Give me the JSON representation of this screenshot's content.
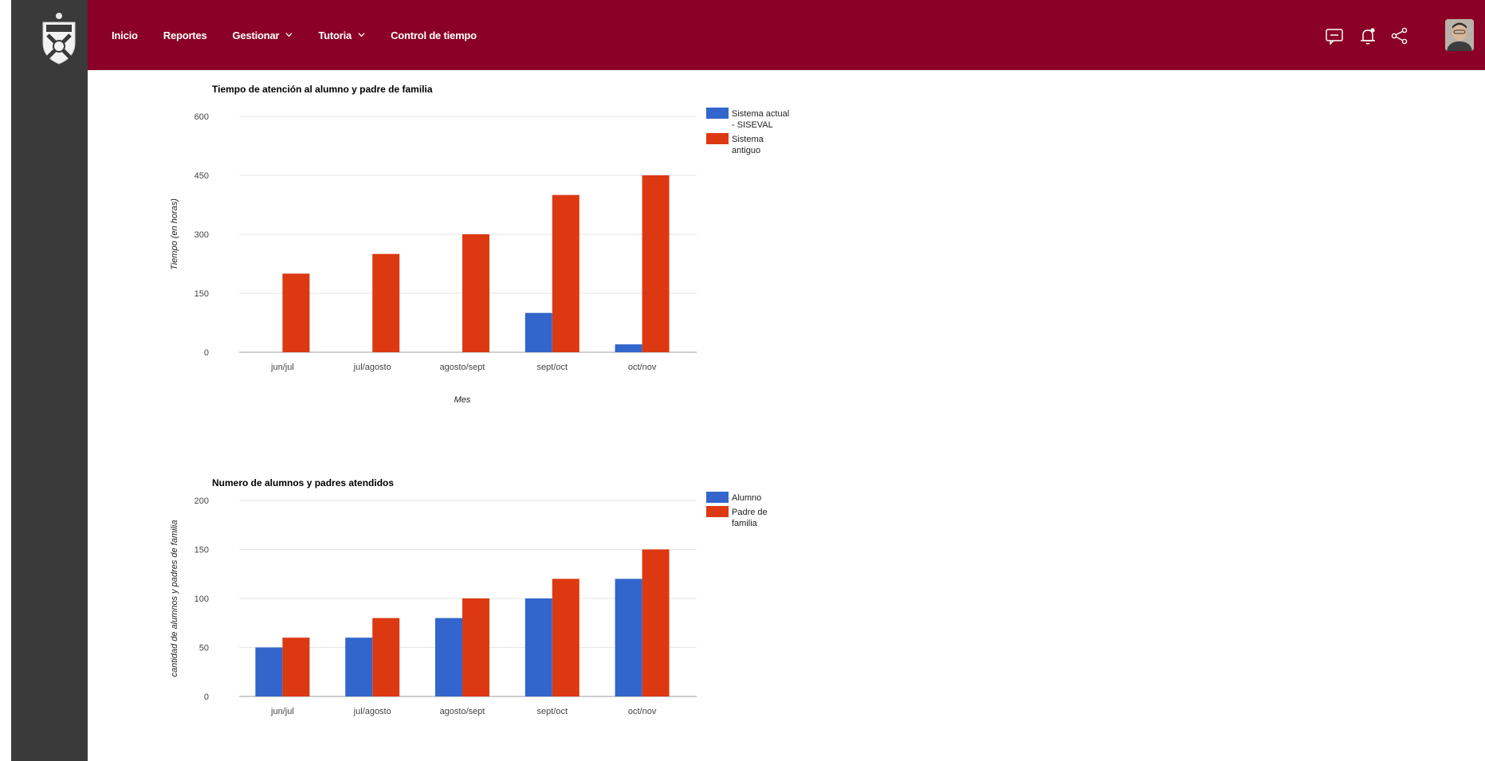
{
  "nav": {
    "items": [
      {
        "label": "Inicio",
        "has_dropdown": false
      },
      {
        "label": "Reportes",
        "has_dropdown": false
      },
      {
        "label": "Gestionar",
        "has_dropdown": true
      },
      {
        "label": "Tutoria",
        "has_dropdown": true
      },
      {
        "label": "Control de tiempo",
        "has_dropdown": false
      }
    ]
  },
  "colors": {
    "topbar": "#8b0026",
    "sidebar": "#3a3a3a",
    "series_blue": "#3366cc",
    "series_red": "#dc3912",
    "grid": "#e6e6e6"
  },
  "icons": [
    "chat-icon",
    "bell-icon",
    "share-icon"
  ],
  "chart_data": [
    {
      "type": "bar",
      "title": "Tiempo de atención al alumno y padre de familia",
      "xlabel": "Mes",
      "ylabel": "Tiempo (en horas)",
      "categories": [
        "jun/jul",
        "jul/agosto",
        "agosto/sept",
        "sept/oct",
        "oct/nov"
      ],
      "ylim": [
        0,
        600
      ],
      "yticks": [
        0,
        150,
        300,
        450,
        600
      ],
      "grid": true,
      "legend_position": "right",
      "series": [
        {
          "name": "Sistema actual - SISEVAL",
          "legend_lines": [
            "Sistema actual",
            "- SISEVAL"
          ],
          "color": "#3366cc",
          "values": [
            0,
            0,
            0,
            100,
            20
          ]
        },
        {
          "name": "Sistema antiguo",
          "legend_lines": [
            "Sistema",
            "antiguo"
          ],
          "color": "#dc3912",
          "values": [
            200,
            250,
            300,
            400,
            450
          ]
        }
      ]
    },
    {
      "type": "bar",
      "title": "Numero de alumnos y padres atendidos",
      "xlabel": "",
      "ylabel": "cantidad de alumnos y padres de familia",
      "categories": [
        "jun/jul",
        "jul/agosto",
        "agosto/sept",
        "sept/oct",
        "oct/nov"
      ],
      "ylim": [
        0,
        200
      ],
      "yticks": [
        0,
        50,
        100,
        150,
        200
      ],
      "grid": true,
      "legend_position": "right",
      "series": [
        {
          "name": "Alumno",
          "legend_lines": [
            "Alumno"
          ],
          "color": "#3366cc",
          "values": [
            50,
            60,
            80,
            100,
            120
          ]
        },
        {
          "name": "Padre de familia",
          "legend_lines": [
            "Padre de",
            "familia"
          ],
          "color": "#dc3912",
          "values": [
            60,
            80,
            100,
            120,
            150
          ]
        }
      ]
    }
  ]
}
